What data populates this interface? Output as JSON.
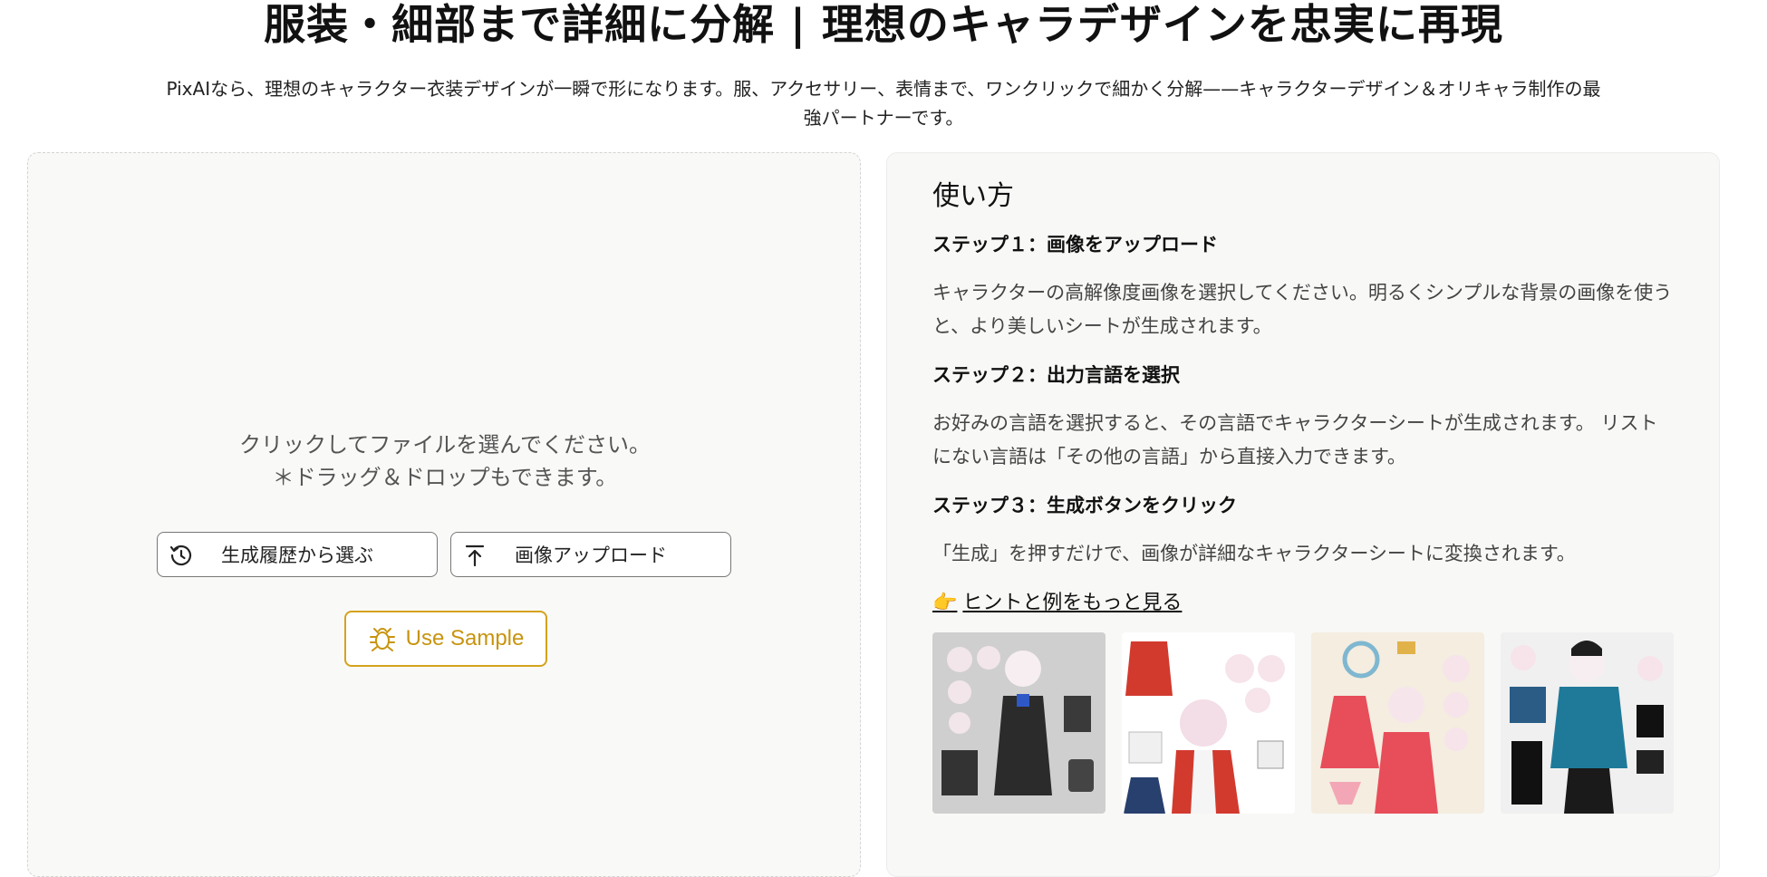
{
  "hero": {
    "title": "服装・細部まで詳細に分解 | 理想のキャラデザインを忠実に再現",
    "subtitle": "PixAIなら、理想のキャラクター衣装デザインが一瞬で形になります。服、アクセサリー、表情まで、ワンクリックで細かく分解——キャラクターデザイン＆オリキャラ制作の最強パートナーです。"
  },
  "upload": {
    "hint_line1": "クリックしてファイルを選んでください。",
    "hint_line2": "＊ドラッグ＆ドロップもできます。",
    "history_label": "生成履歴から選ぶ",
    "upload_label": "画像アップロード",
    "sample_label": "Use Sample",
    "icons": {
      "history": "history-icon",
      "upload": "upload-arrow-icon",
      "sample": "bug-icon"
    },
    "colors": {
      "accent": "#d4a21c"
    }
  },
  "guide": {
    "title": "使い方",
    "steps": [
      {
        "heading": "ステップ１：画像をアップロード",
        "body": "キャラクターの高解像度画像を選択してください。明るくシンプルな背景の画像を使うと、より美しいシートが生成されます。"
      },
      {
        "heading": "ステップ２：出力言語を選択",
        "body": "お好みの言語を選択すると、その言語でキャラクターシートが生成されます。 リストにない言語は「その他の言語」から直接入力できます。"
      },
      {
        "heading": "ステップ３：生成ボタンをクリック",
        "body": "「生成」を押すだけで、画像が詳細なキャラクターシートに変換されます。"
      }
    ],
    "more_emoji": "👉",
    "more_label": "ヒントと例をもっと見る"
  },
  "examples": [
    {
      "name": "example-thumb-1",
      "bg": "#cfcfcf"
    },
    {
      "name": "example-thumb-2",
      "bg": "#ffffff"
    },
    {
      "name": "example-thumb-3",
      "bg": "#f4ede0"
    },
    {
      "name": "example-thumb-4",
      "bg": "#f0f0f0"
    }
  ]
}
